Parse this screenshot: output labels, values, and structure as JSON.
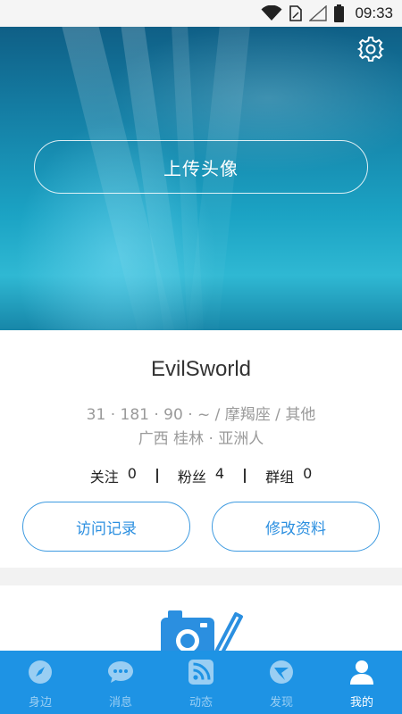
{
  "status_bar": {
    "time": "09:33",
    "icons": [
      "wifi-icon",
      "sim-card-icon",
      "signal-icon",
      "battery-icon"
    ]
  },
  "hero": {
    "upload_avatar_label": "上传头像",
    "settings_icon": "gear-icon"
  },
  "profile": {
    "username": "EvilSworld",
    "info_line_1": "31 · 181 · 90 · ~ / 摩羯座 / 其他",
    "info_line_2": "广西 桂林 · 亚洲人",
    "stats": [
      {
        "label": "关注",
        "value": "0"
      },
      {
        "label": "粉丝",
        "value": "4"
      },
      {
        "label": "群组",
        "value": "0"
      }
    ],
    "visit_record_label": "访问记录",
    "edit_profile_label": "修改资料"
  },
  "tabs": [
    {
      "label": "身边",
      "icon": "compass-icon",
      "active": false
    },
    {
      "label": "消息",
      "icon": "chat-bubble-icon",
      "active": false
    },
    {
      "label": "动态",
      "icon": "rss-feed-icon",
      "active": false
    },
    {
      "label": "发现",
      "icon": "discover-icon",
      "active": false
    },
    {
      "label": "我的",
      "icon": "person-icon",
      "active": true
    }
  ],
  "colors": {
    "accent": "#1e93e4",
    "button_border": "#3d9ae0",
    "text_secondary": "#9a9a9a"
  }
}
